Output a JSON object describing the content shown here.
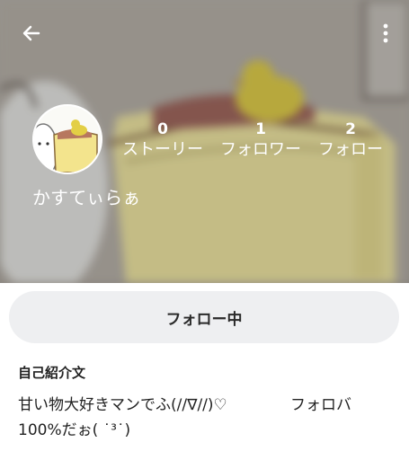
{
  "header": {
    "back_icon": "arrow-left-icon",
    "menu_icon": "more-vert-icon",
    "text_color": "#ffffff"
  },
  "profile": {
    "username": "かすてぃらぁ",
    "avatar": "avatar-image",
    "stats": [
      {
        "count": "0",
        "label": "ストーリー"
      },
      {
        "count": "1",
        "label": "フォロワー"
      },
      {
        "count": "2",
        "label": "フォロー"
      }
    ]
  },
  "actions": {
    "follow_label": "フォロー中",
    "button_color": "#eeeff1"
  },
  "bio": {
    "heading": "自己紹介文",
    "text": "甘い物大好きマンでふ(//∇//)♡             フォロバ100%だぉ( ˙³˙)"
  }
}
